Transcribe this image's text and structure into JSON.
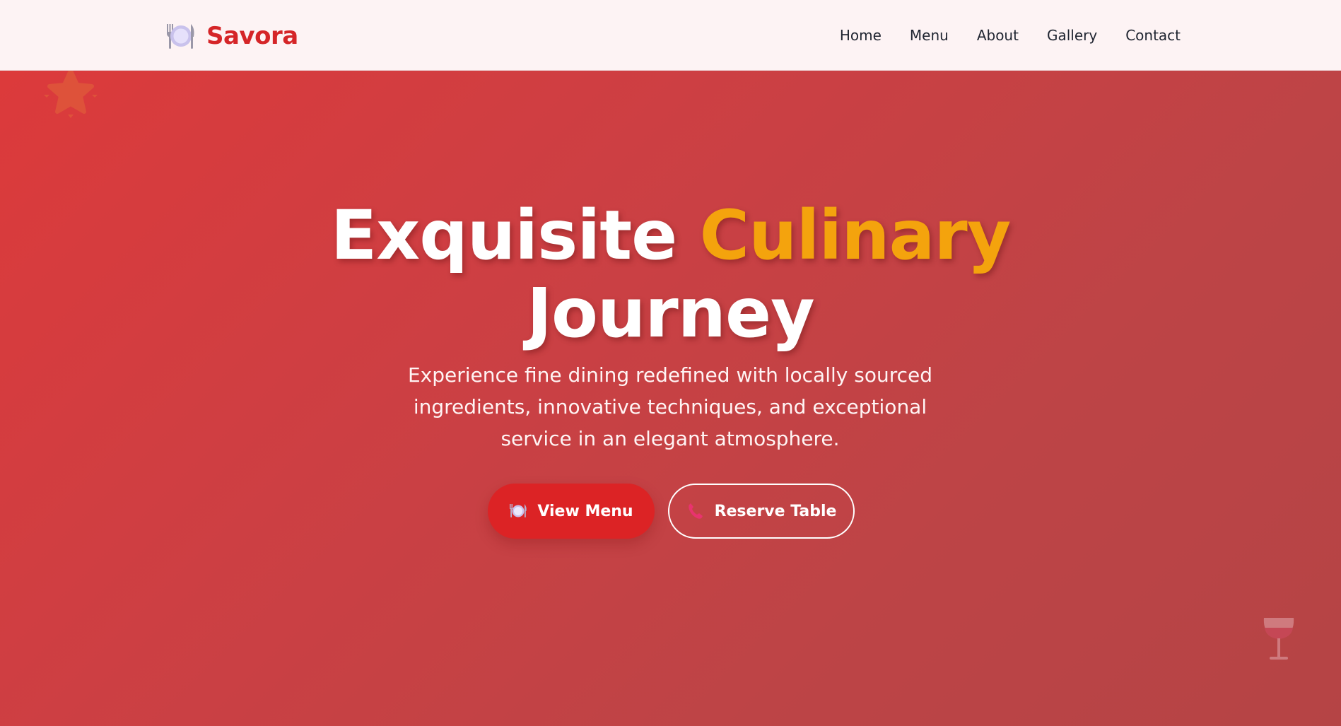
{
  "brand": {
    "name": "Savora",
    "icon": "plate-with-cutlery-icon",
    "color": "#d52528"
  },
  "nav": {
    "items": [
      {
        "label": "Home"
      },
      {
        "label": "Menu"
      },
      {
        "label": "About"
      },
      {
        "label": "Gallery"
      },
      {
        "label": "Contact"
      }
    ]
  },
  "hero": {
    "title_part1": "Exquisite",
    "title_accent": "Culinary",
    "title_part2": "Journey",
    "subtitle": "Experience fine dining redefined with locally sourced ingredients, innovative techniques, and exceptional service in an elegant atmosphere.",
    "primary_button": {
      "label": "View Menu",
      "icon": "plate-with-cutlery-icon"
    },
    "secondary_button": {
      "label": "Reserve Table",
      "icon": "phone-icon"
    },
    "decorations": [
      "star-icon",
      "wine-glass-icon"
    ]
  },
  "colors": {
    "accent": "#f4a30d",
    "hero_background": "#c94044",
    "primary_button": "#dc2325",
    "nav_background": "#fdf3f4"
  }
}
